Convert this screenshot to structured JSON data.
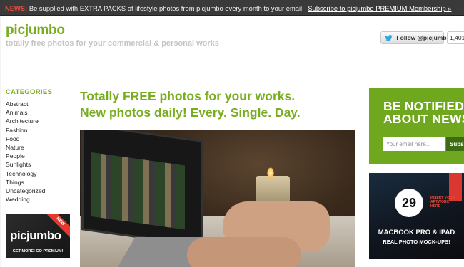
{
  "newsbar": {
    "label": "NEWS:",
    "text": "Be supplied with EXTRA PACKS of lifestyle photos from picjumbo every month to your email.",
    "link": "Subscribe to picjumbo PREMIUM Membership »"
  },
  "header": {
    "title": "picjumbo",
    "tagline": "totally free photos for your commercial & personal works",
    "twitter_follow_label": "Follow @picjumbo",
    "follower_count": "1,401"
  },
  "sidebar": {
    "heading": "CATEGORIES",
    "categories": [
      "Abstract",
      "Animals",
      "Architecture",
      "Fashion",
      "Food",
      "Nature",
      "People",
      "Sunlights",
      "Technology",
      "Things",
      "Uncategorized",
      "Wedding"
    ],
    "promo": {
      "ribbon": "NEW",
      "logo": "picjumbo",
      "cta": "GET MORE! GO PREMIUM!"
    }
  },
  "main": {
    "headline_line1": "Totally FREE photos for your works.",
    "headline_line2": "New photos daily! Every. Single. Day."
  },
  "right": {
    "notify_title": "BE NOTIFIED\nABOUT NEWS",
    "email_placeholder": "Your email here...",
    "subscribe_label": "Subs",
    "mockup": {
      "number": "29",
      "insert_text": "INSERT YOUR ARTWORK HERE",
      "title": "MACBOOK PRO & IPAD",
      "subtitle": "REAL PHOTO MOCK-UPS!"
    }
  },
  "colors": {
    "brand_green": "#78ad1f",
    "news_red": "#e84b3c",
    "notify_green": "#6fa81f"
  }
}
